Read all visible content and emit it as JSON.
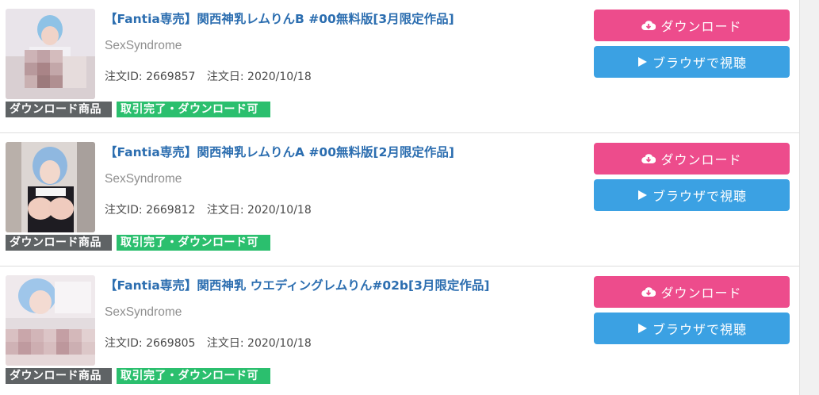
{
  "items": [
    {
      "title": "【Fantia専売】関西神乳レムりんB #00無料版[3月限定作品]",
      "creator": "SexSyndrome",
      "order_id": "注文ID: 2669857",
      "order_date": "注文日: 2020/10/18",
      "badge_type": "ダウンロード商品",
      "badge_status": "取引完了・ダウンロード可",
      "download_label": "ダウンロード",
      "view_label": "ブラウザで視聴"
    },
    {
      "title": "【Fantia専売】関西神乳レムりんA #00無料版[2月限定作品]",
      "creator": "SexSyndrome",
      "order_id": "注文ID: 2669812",
      "order_date": "注文日: 2020/10/18",
      "badge_type": "ダウンロード商品",
      "badge_status": "取引完了・ダウンロード可",
      "download_label": "ダウンロード",
      "view_label": "ブラウザで視聴"
    },
    {
      "title": "【Fantia専売】関西神乳 ウエディングレムりん#02b[3月限定作品]",
      "creator": "SexSyndrome",
      "order_id": "注文ID: 2669805",
      "order_date": "注文日: 2020/10/18",
      "badge_type": "ダウンロード商品",
      "badge_status": "取引完了・ダウンロード可",
      "download_label": "ダウンロード",
      "view_label": "ブラウザで視聴"
    }
  ],
  "icons": {
    "download": "cloud-download-icon",
    "view": "play-icon"
  },
  "colors": {
    "title": "#2c6eb0",
    "download_button": "#ed4c8c",
    "view_button": "#3ba1e3",
    "badge_type": "#5f6365",
    "badge_status": "#2bbf6e"
  }
}
